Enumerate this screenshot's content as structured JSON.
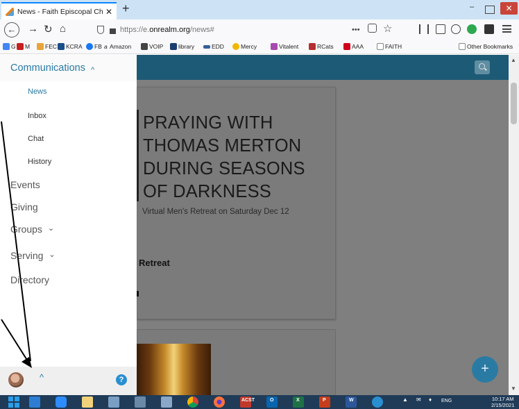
{
  "browser": {
    "tab_title": "News - Faith Episcopal Church",
    "tab_close": "✕",
    "new_tab": "+",
    "url_prefix": "https://e.",
    "url_domain": "onrealm.org",
    "url_path": "/news#",
    "url_dots": "•••",
    "win_minimize": "–",
    "win_close": "✕"
  },
  "bookmarks": [
    {
      "label": "G",
      "color": "#4285f4"
    },
    {
      "label": "M",
      "color": "#c5221f"
    },
    {
      "label": "FEC",
      "color": "#e8a33a"
    },
    {
      "label": "KCRA",
      "color": "#1b4f8a"
    },
    {
      "label": "FB",
      "color": "#1877f2"
    },
    {
      "label": "Amazon",
      "color": "#222222"
    },
    {
      "label": "VOIP",
      "color": "#444444"
    },
    {
      "label": "library",
      "color": "#1b3e6d"
    },
    {
      "label": "EDD",
      "color": "#355e9b"
    },
    {
      "label": "Mercy",
      "color": "#f2b705"
    },
    {
      "label": "Vitalent",
      "color": "#a74ab0"
    },
    {
      "label": "RCats",
      "color": "#b52f2f"
    },
    {
      "label": "AAA",
      "color": "#d0021b"
    },
    {
      "label": "FAITH",
      "color": "#999999"
    },
    {
      "label": "Other Bookmarks",
      "color": "#999999"
    }
  ],
  "sidebar": {
    "section_title": "Communications",
    "section_chevron": "^",
    "sub_items": [
      "News",
      "Inbox",
      "Chat",
      "History"
    ],
    "items": [
      "Events",
      "Giving",
      "Groups",
      "Serving",
      "Directory"
    ],
    "dropdown_chevron": "⌄",
    "footer_chevron": "^",
    "help_symbol": "?"
  },
  "content": {
    "headline_lines": [
      "PRAYING WITH",
      "THOMAS MERTON",
      "DURING SEASONS",
      "OF DARKNESS"
    ],
    "subline": "Virtual Men's Retreat on Saturday Dec 12",
    "card_title_fragment": "Retreat",
    "fab_symbol": "+"
  },
  "taskbar": {
    "clock_time": "10:17 AM",
    "clock_date": "2/15/2021",
    "tray_lang": "ENG",
    "icons": [
      "windows-start",
      "file-explorer",
      "zoom",
      "notes",
      "pen",
      "calendar",
      "paint",
      "chrome",
      "firefox",
      "acst",
      "outlook",
      "excel",
      "powerpoint",
      "word",
      "help"
    ],
    "labels": {
      "acst": "ACST",
      "outlook": "O",
      "excel": "X",
      "powerpoint": "P",
      "word": "W"
    }
  },
  "colors": {
    "accent": "#2a79a3",
    "header": "#1d5a75",
    "overlay": "#7f7f7f",
    "fab": "#2a7ba4",
    "help": "#2a8fd0"
  }
}
